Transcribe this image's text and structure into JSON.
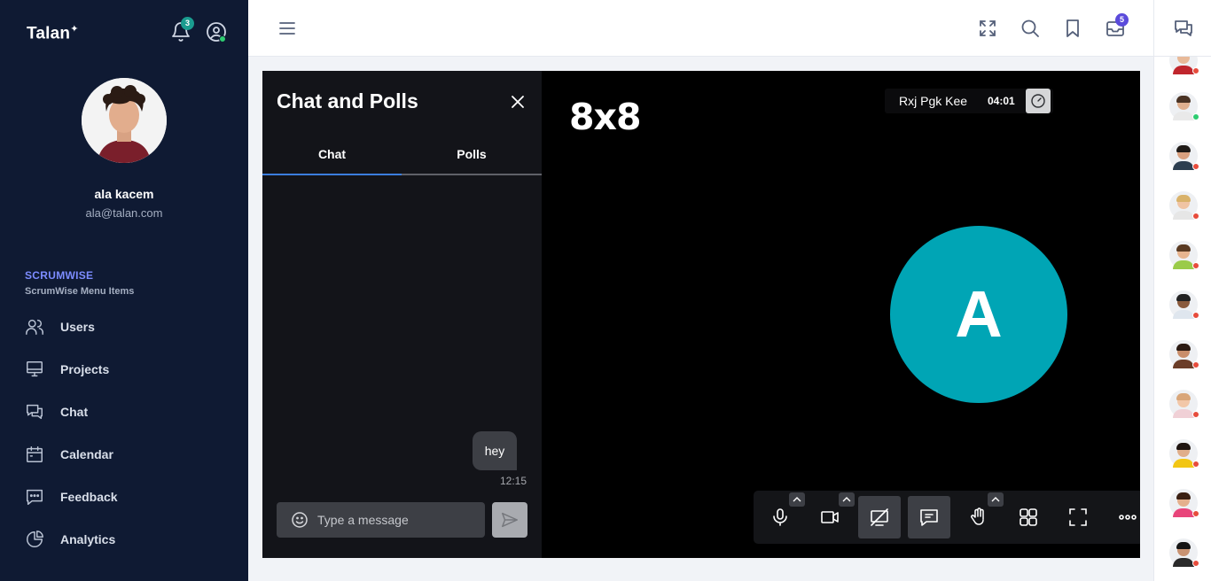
{
  "sidebar": {
    "brand": "Talan",
    "notifications_count": "3",
    "profile": {
      "name": "ala kacem",
      "email": "ala@talan.com"
    },
    "section_title": "SCRUMWISE",
    "section_subtitle": "ScrumWise Menu Items",
    "items": [
      {
        "label": "Users",
        "icon": "users-icon"
      },
      {
        "label": "Projects",
        "icon": "monitor-icon"
      },
      {
        "label": "Chat",
        "icon": "chat-icon"
      },
      {
        "label": "Calendar",
        "icon": "calendar-icon"
      },
      {
        "label": "Feedback",
        "icon": "feedback-icon"
      },
      {
        "label": "Analytics",
        "icon": "pie-chart-icon"
      }
    ]
  },
  "topbar": {
    "icons": [
      "menu-icon",
      "fullscreen-icon",
      "search-icon",
      "bookmark-icon",
      "inbox-icon"
    ],
    "inbox_count": "5"
  },
  "chat_panel": {
    "title": "Chat and Polls",
    "tabs": [
      {
        "label": "Chat",
        "active": true
      },
      {
        "label": "Polls",
        "active": false
      }
    ],
    "messages": [
      {
        "text": "hey",
        "time": "12:15"
      }
    ],
    "input_placeholder": "Type a message"
  },
  "meeting": {
    "logo": "8x8",
    "room_name": "Rxj Pgk Kee",
    "elapsed": "04:01",
    "participant_initial": "A",
    "avatar_color": "#00a5b5",
    "toolbar": [
      "microphone-icon",
      "camera-icon",
      "screen-share-icon",
      "chat-icon",
      "raise-hand-icon",
      "tile-view-icon",
      "fullscreen-icon",
      "more-icon"
    ]
  },
  "contacts": [
    {
      "status": "offline"
    },
    {
      "status": "online"
    },
    {
      "status": "offline"
    },
    {
      "status": "offline"
    },
    {
      "status": "offline"
    },
    {
      "status": "offline"
    },
    {
      "status": "offline"
    },
    {
      "status": "offline"
    },
    {
      "status": "offline"
    },
    {
      "status": "offline"
    },
    {
      "status": "offline"
    }
  ],
  "colors": {
    "sidebar_bg": "#0f1a33",
    "accent": "#7c8cff",
    "online": "#2ecc71",
    "offline": "#e74c3c",
    "teal": "#00a5b5"
  }
}
